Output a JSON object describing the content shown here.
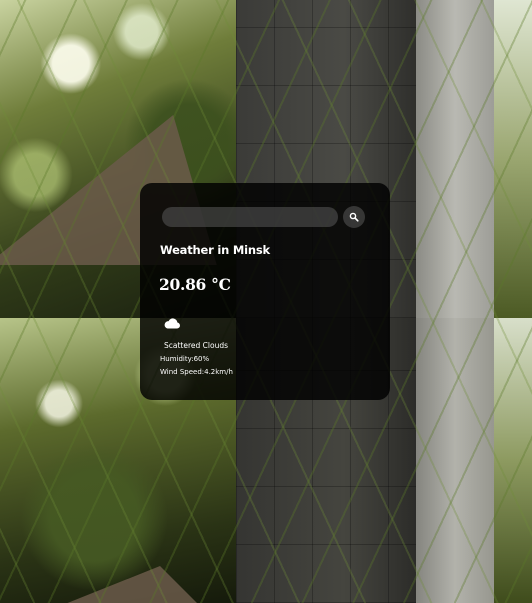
{
  "search": {
    "placeholder": "",
    "value": ""
  },
  "weather": {
    "title": "Weather in Minsk",
    "temperature": "20.86 °C",
    "description": "Scattered Clouds",
    "humidity": "Humidity:60%",
    "wind": "Wind Speed:4.2km/h",
    "icon": "cloud-icon"
  },
  "colors": {
    "card_background": "#000000",
    "text": "#ffffff",
    "input_background": "#5a5a5a"
  }
}
